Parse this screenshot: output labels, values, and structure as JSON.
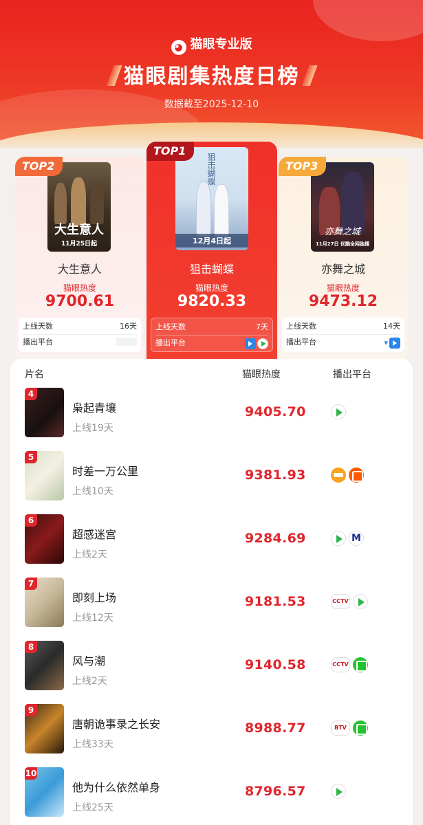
{
  "header": {
    "brand": "猫眼专业版",
    "brand_icon": "cat-logo-icon",
    "title": "猫眼剧集热度日榜",
    "subtitle": "数据截至2025-12-10"
  },
  "colors": {
    "accent": "#e0262d",
    "header_red": "#e8231f",
    "top2": "#f06a3a",
    "top3": "#f5a93a"
  },
  "top3": {
    "second": {
      "badge": "TOP2",
      "name": "大生意人",
      "label": "猫眼热度",
      "value": "9700.61",
      "days_label": "上线天数",
      "days": "16天",
      "platform_label": "播出平台",
      "poster_text": "11月25日起",
      "platforms": []
    },
    "first": {
      "badge": "TOP1",
      "name": "狙击蝴蝶",
      "label": "猫眼热度",
      "value": "9820.33",
      "days_label": "上线天数",
      "days": "7天",
      "platform_label": "播出平台",
      "poster_text": "12月4日起",
      "platforms": [
        "youku",
        "tencent"
      ]
    },
    "third": {
      "badge": "TOP3",
      "name": "亦舞之城",
      "label": "猫眼热度",
      "value": "9473.12",
      "days_label": "上线天数",
      "days": "14天",
      "platform_label": "播出平台",
      "poster_text": "11月27日 优酷全网独播",
      "platforms": [
        "migu-icon",
        "youku"
      ]
    }
  },
  "list": {
    "headers": {
      "name": "片名",
      "heat": "猫眼热度",
      "platform": "播出平台"
    },
    "items": [
      {
        "rank": "4",
        "name": "枭起青壤",
        "days": "上线19天",
        "value": "9405.70",
        "platforms": [
          "tencent"
        ]
      },
      {
        "rank": "5",
        "name": "时差一万公里",
        "days": "上线10天",
        "value": "9381.93",
        "platforms": [
          "mgtv",
          "mgtv2"
        ]
      },
      {
        "rank": "6",
        "name": "超感迷宫",
        "days": "上线2天",
        "value": "9284.69",
        "platforms": [
          "tencent",
          "migu"
        ]
      },
      {
        "rank": "7",
        "name": "即刻上场",
        "days": "上线12天",
        "value": "9181.53",
        "platforms": [
          "cctv",
          "tencent"
        ]
      },
      {
        "rank": "8",
        "name": "风与潮",
        "days": "上线2天",
        "value": "9140.58",
        "platforms": [
          "cctv",
          "iqiyi"
        ]
      },
      {
        "rank": "9",
        "name": "唐朝诡事录之长安",
        "days": "上线33天",
        "value": "8988.77",
        "platforms": [
          "btv",
          "iqiyi"
        ]
      },
      {
        "rank": "10",
        "name": "他为什么依然单身",
        "days": "上线25天",
        "value": "8796.57",
        "platforms": [
          "tencent"
        ]
      }
    ]
  }
}
